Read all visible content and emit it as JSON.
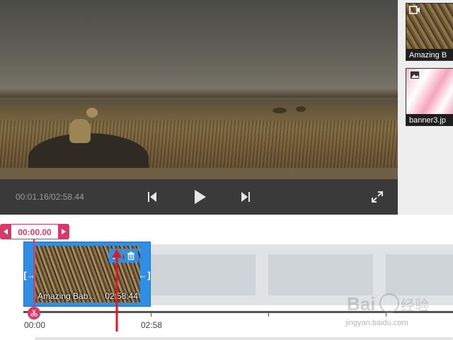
{
  "player": {
    "time_readout": "00:01.16/02:58.44",
    "prev_icon": "skip-back-icon",
    "play_icon": "play-icon",
    "next_icon": "skip-forward-icon",
    "fullscreen_icon": "fullscreen-icon"
  },
  "library": {
    "items": [
      {
        "type": "video",
        "type_icon": "video-camera-icon",
        "name": "Amazing B"
      },
      {
        "type": "image",
        "type_icon": "image-icon",
        "name": "banner3.jp"
      }
    ]
  },
  "timeline": {
    "playhead_time": "00:00.00",
    "clip": {
      "title": "Amazing Bab...",
      "duration": "02:58.44",
      "edit_icon": "pencil-icon",
      "delete_icon": "trash-icon",
      "handle_left_symbol": "[→",
      "handle_right_symbol": "←]"
    },
    "ruler": {
      "start_label": "00:00",
      "end_label": "02:58"
    }
  },
  "watermark": {
    "logo_text": "Bai 经验",
    "site": "jingyan.baidu.com"
  },
  "colors": {
    "accent_pink": "#d9386b",
    "clip_blue": "#2f8fe6",
    "control_bar": "#3a3a3a",
    "annotation_red": "#e8151b"
  }
}
